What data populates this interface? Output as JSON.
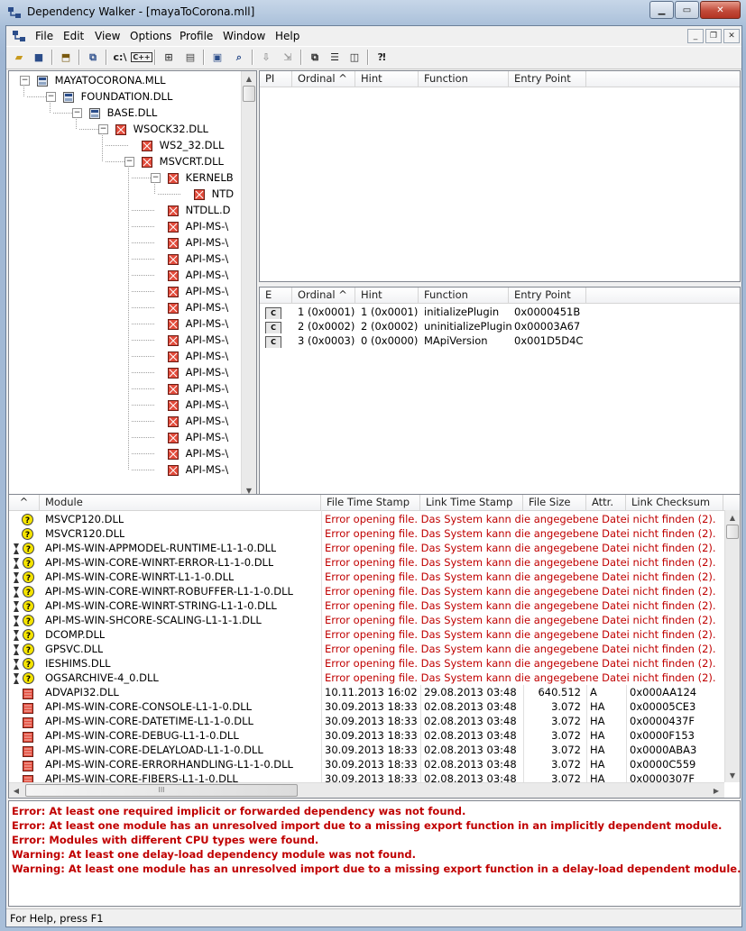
{
  "window": {
    "title": "Dependency Walker - [mayaToCorona.mll]"
  },
  "menu": [
    "File",
    "Edit",
    "View",
    "Options",
    "Profile",
    "Window",
    "Help"
  ],
  "tree": [
    {
      "label": "MAYATOCORONA.MLL",
      "depth": 0
    },
    {
      "label": "FOUNDATION.DLL",
      "depth": 1
    },
    {
      "label": "BASE.DLL",
      "depth": 2
    },
    {
      "label": "WSOCK32.DLL",
      "depth": 3
    },
    {
      "label": "WS2_32.DLL",
      "depth": 4
    },
    {
      "label": "MSVCRT.DLL",
      "depth": 4
    },
    {
      "label": "KERNELB",
      "depth": 5
    },
    {
      "label": "NTD",
      "depth": 6
    },
    {
      "label": "NTDLL.D",
      "depth": 5
    },
    {
      "label": "API-MS-\\",
      "depth": 5
    },
    {
      "label": "API-MS-\\",
      "depth": 5
    },
    {
      "label": "API-MS-\\",
      "depth": 5
    },
    {
      "label": "API-MS-\\",
      "depth": 5
    },
    {
      "label": "API-MS-\\",
      "depth": 5
    },
    {
      "label": "API-MS-\\",
      "depth": 5
    },
    {
      "label": "API-MS-\\",
      "depth": 5
    },
    {
      "label": "API-MS-\\",
      "depth": 5
    },
    {
      "label": "API-MS-\\",
      "depth": 5
    },
    {
      "label": "API-MS-\\",
      "depth": 5
    },
    {
      "label": "API-MS-\\",
      "depth": 5
    },
    {
      "label": "API-MS-\\",
      "depth": 5
    },
    {
      "label": "API-MS-\\",
      "depth": 5
    },
    {
      "label": "API-MS-\\",
      "depth": 5
    },
    {
      "label": "API-MS-\\",
      "depth": 5
    },
    {
      "label": "API-MS-\\",
      "depth": 5
    }
  ],
  "import_pane": {
    "headers": [
      "PI",
      "Ordinal ^",
      "Hint",
      "Function",
      "Entry Point"
    ]
  },
  "export_pane": {
    "headers": [
      "E",
      "Ordinal ^",
      "Hint",
      "Function",
      "Entry Point"
    ],
    "rows": [
      {
        "e": "C",
        "ordinal": "1 (0x0001)",
        "hint": "1 (0x0001)",
        "function": "initializePlugin",
        "entry": "0x0000451B"
      },
      {
        "e": "C",
        "ordinal": "2 (0x0002)",
        "hint": "2 (0x0002)",
        "function": "uninitializePlugin",
        "entry": "0x00003A67"
      },
      {
        "e": "C",
        "ordinal": "3 (0x0003)",
        "hint": "0 (0x0000)",
        "function": "MApiVersion",
        "entry": "0x001D5D4C"
      }
    ]
  },
  "module_list": {
    "headers": [
      "^",
      "Module",
      "File Time Stamp",
      "Link Time Stamp",
      "File Size",
      "Attr.",
      "Link Checksum"
    ],
    "error_text": "Error opening file. Das System kann die angegebene Datei nicht finden (2).",
    "rows": [
      {
        "icon": "question",
        "name": "MSVCP120.DLL",
        "error": true
      },
      {
        "icon": "question",
        "name": "MSVCR120.DLL",
        "error": true
      },
      {
        "icon": "hourglass-question",
        "name": "API-MS-WIN-APPMODEL-RUNTIME-L1-1-0.DLL",
        "error": true
      },
      {
        "icon": "hourglass-question",
        "name": "API-MS-WIN-CORE-WINRT-ERROR-L1-1-0.DLL",
        "error": true
      },
      {
        "icon": "hourglass-question",
        "name": "API-MS-WIN-CORE-WINRT-L1-1-0.DLL",
        "error": true
      },
      {
        "icon": "hourglass-question",
        "name": "API-MS-WIN-CORE-WINRT-ROBUFFER-L1-1-0.DLL",
        "error": true
      },
      {
        "icon": "hourglass-question",
        "name": "API-MS-WIN-CORE-WINRT-STRING-L1-1-0.DLL",
        "error": true
      },
      {
        "icon": "hourglass-question",
        "name": "API-MS-WIN-SHCORE-SCALING-L1-1-1.DLL",
        "error": true
      },
      {
        "icon": "hourglass-question",
        "name": "DCOMP.DLL",
        "error": true
      },
      {
        "icon": "hourglass-question",
        "name": "GPSVC.DLL",
        "error": true
      },
      {
        "icon": "hourglass-question",
        "name": "IESHIMS.DLL",
        "error": true
      },
      {
        "icon": "hourglass-question",
        "name": "OGSARCHIVE-4_0.DLL",
        "error": true
      },
      {
        "icon": "module",
        "name": "ADVAPI32.DLL",
        "error": false,
        "file_ts": "10.11.2013 16:02",
        "link_ts": "29.08.2013 03:48",
        "size": "640.512",
        "attr": "A",
        "checksum": "0x000AA124"
      },
      {
        "icon": "module",
        "name": "API-MS-WIN-CORE-CONSOLE-L1-1-0.DLL",
        "error": false,
        "file_ts": "30.09.2013 18:33",
        "link_ts": "02.08.2013 03:48",
        "size": "3.072",
        "attr": "HA",
        "checksum": "0x00005CE3"
      },
      {
        "icon": "module",
        "name": "API-MS-WIN-CORE-DATETIME-L1-1-0.DLL",
        "error": false,
        "file_ts": "30.09.2013 18:33",
        "link_ts": "02.08.2013 03:48",
        "size": "3.072",
        "attr": "HA",
        "checksum": "0x0000437F"
      },
      {
        "icon": "module",
        "name": "API-MS-WIN-CORE-DEBUG-L1-1-0.DLL",
        "error": false,
        "file_ts": "30.09.2013 18:33",
        "link_ts": "02.08.2013 03:48",
        "size": "3.072",
        "attr": "HA",
        "checksum": "0x0000F153"
      },
      {
        "icon": "module",
        "name": "API-MS-WIN-CORE-DELAYLOAD-L1-1-0.DLL",
        "error": false,
        "file_ts": "30.09.2013 18:33",
        "link_ts": "02.08.2013 03:48",
        "size": "3.072",
        "attr": "HA",
        "checksum": "0x0000ABA3"
      },
      {
        "icon": "module",
        "name": "API-MS-WIN-CORE-ERRORHANDLING-L1-1-0.DLL",
        "error": false,
        "file_ts": "30.09.2013 18:33",
        "link_ts": "02.08.2013 03:48",
        "size": "3.072",
        "attr": "HA",
        "checksum": "0x0000C559"
      },
      {
        "icon": "module",
        "name": "API-MS-WIN-CORE-FIBERS-L1-1-0.DLL",
        "error": false,
        "file_ts": "30.09.2013 18:33",
        "link_ts": "02.08.2013 03:48",
        "size": "3.072",
        "attr": "HA",
        "checksum": "0x0000307F"
      }
    ]
  },
  "log": [
    "Error: At least one required implicit or forwarded dependency was not found.",
    "Error: At least one module has an unresolved import due to a missing export function in an implicitly dependent module.",
    "Error: Modules with different CPU types were found.",
    "Warning: At least one delay-load dependency module was not found.",
    "Warning: At least one module has an unresolved import due to a missing export function in a delay-load dependent module."
  ],
  "status": "For Help, press F1",
  "colors": {
    "error": "#c00000",
    "module_red": "#c0392b",
    "warn_yellow": "#f5e400"
  }
}
